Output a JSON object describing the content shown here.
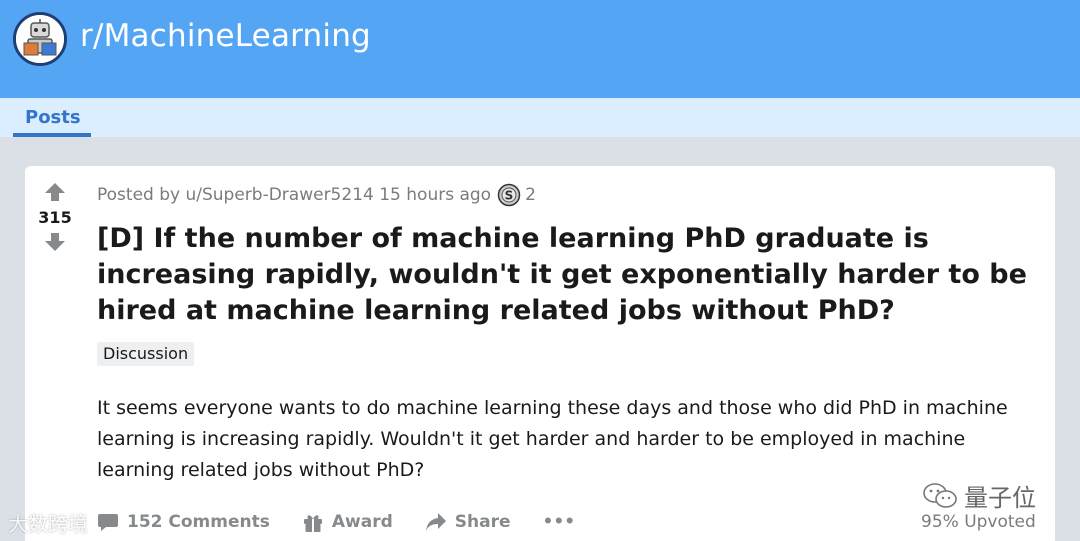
{
  "header": {
    "subreddit": "r/MachineLearning"
  },
  "tabs": {
    "posts": "Posts"
  },
  "post": {
    "score": "315",
    "posted_by": "Posted by u/Superb-Drawer5214 15 hours ago",
    "award_count": "2",
    "title": "[D] If the number of machine learning PhD graduate is increasing rapidly, wouldn't it get exponentially harder to be hired at machine learning related jobs without PhD?",
    "flair": "Discussion",
    "body": "It seems everyone wants to do machine learning these days and those who did PhD in machine learning is increasing rapidly. Wouldn't it get harder and harder to be employed in machine learning related jobs without PhD?",
    "comments": "152 Comments",
    "award_label": "Award",
    "share_label": "Share",
    "more": "•••",
    "upvoted": "95% Upvoted"
  },
  "watermarks": {
    "left": "大数跨境",
    "right": "量子位"
  },
  "colors": {
    "header": "#55a5f5",
    "tabbar": "#dbeeff",
    "accent": "#3375c8",
    "background": "#dae0e6"
  },
  "icons": [
    "subreddit-avatar-icon",
    "upvote-arrow-icon",
    "downvote-arrow-icon",
    "silver-award-icon",
    "comment-icon",
    "gift-icon",
    "share-arrow-icon",
    "more-options-icon",
    "wechat-icon"
  ]
}
